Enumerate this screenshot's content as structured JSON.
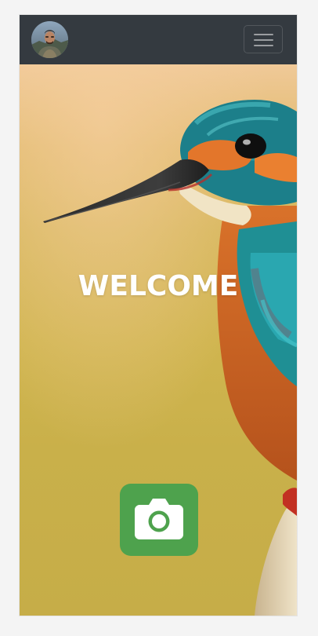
{
  "navbar": {
    "avatar_icon": "profile-photo",
    "menu_icon": "hamburger-icon",
    "background_color": "#343a40"
  },
  "hero": {
    "title": "WELCOME",
    "background_image": "kingfisher-bird"
  },
  "camera_button": {
    "icon": "camera-icon",
    "color": "#4ea24d"
  }
}
